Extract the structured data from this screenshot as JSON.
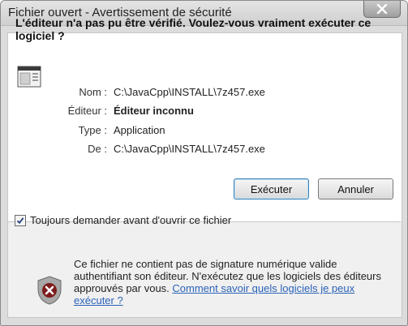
{
  "window": {
    "title": "Fichier ouvert - Avertissement de sécurité"
  },
  "dialog": {
    "question": "L'éditeur n'a pas pu être vérifié. Voulez-vous vraiment exécuter ce logiciel ?",
    "fields": [
      {
        "label": "Nom :",
        "value": "C:\\JavaCpp\\INSTALL\\7z457.exe",
        "bold": false
      },
      {
        "label": "Éditeur :",
        "value": "Éditeur inconnu",
        "bold": true
      },
      {
        "label": "Type :",
        "value": "Application",
        "bold": false
      },
      {
        "label": "De :",
        "value": "C:\\JavaCpp\\INSTALL\\7z457.exe",
        "bold": false
      }
    ],
    "buttons": {
      "run": "Exécuter",
      "cancel": "Annuler"
    },
    "checkbox": {
      "label": "Toujours demander avant d'ouvrir ce fichier",
      "checked": true
    },
    "warning": {
      "text": "Ce fichier ne contient pas de signature numérique valide authentifiant son éditeur. N'exécutez que les logiciels des éditeurs approuvés par vous. ",
      "link": "Comment savoir quels logiciels je peux exécuter ?"
    }
  },
  "icons": {
    "close": "close-icon",
    "file": "file-icon",
    "shield": "shield-warning-icon",
    "check": "checkmark-icon"
  }
}
